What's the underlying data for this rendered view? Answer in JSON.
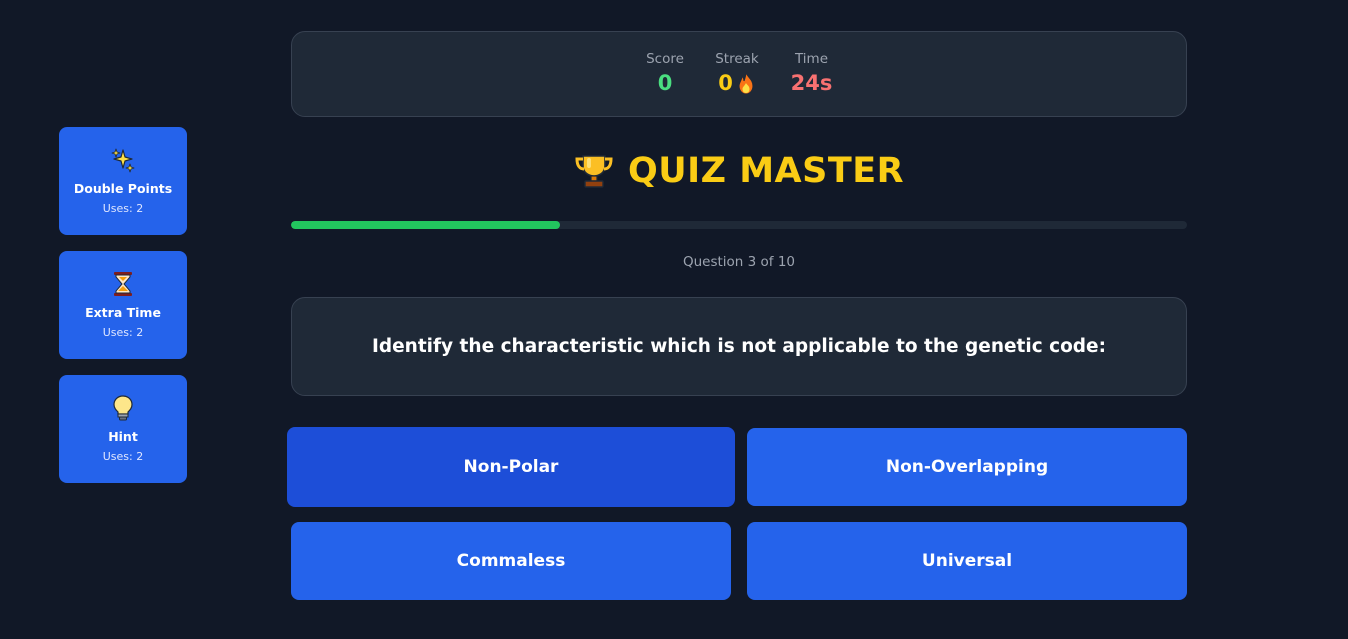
{
  "powerups": [
    {
      "name": "Double Points",
      "uses": "Uses: 2",
      "icon": "sparkles-icon"
    },
    {
      "name": "Extra Time",
      "uses": "Uses: 2",
      "icon": "hourglass-icon"
    },
    {
      "name": "Hint",
      "uses": "Uses: 2",
      "icon": "lightbulb-icon"
    }
  ],
  "stats": {
    "score_label": "Score",
    "score_value": "0",
    "streak_label": "Streak",
    "streak_value": "0",
    "streak_icon": "fire-icon",
    "time_label": "Time",
    "time_value": "24s"
  },
  "title": {
    "icon": "trophy-icon",
    "text": "QUIZ MASTER"
  },
  "progress": {
    "current": 3,
    "total": 10,
    "fraction": 0.3,
    "counter_text": "Question 3 of 10"
  },
  "question": {
    "text": "Identify the characteristic which is not applicable to the genetic code:"
  },
  "answers": [
    {
      "label": "Non-Polar"
    },
    {
      "label": "Non-Overlapping"
    },
    {
      "label": "Commaless"
    },
    {
      "label": "Universal"
    }
  ],
  "colors": {
    "background": "#111827",
    "card": "#1f2937",
    "accent_blue": "#2563eb",
    "score_green": "#4ade80",
    "streak_yellow": "#facc15",
    "time_red": "#f87171",
    "title_yellow": "#facc15",
    "progress_green": "#22c55e"
  }
}
